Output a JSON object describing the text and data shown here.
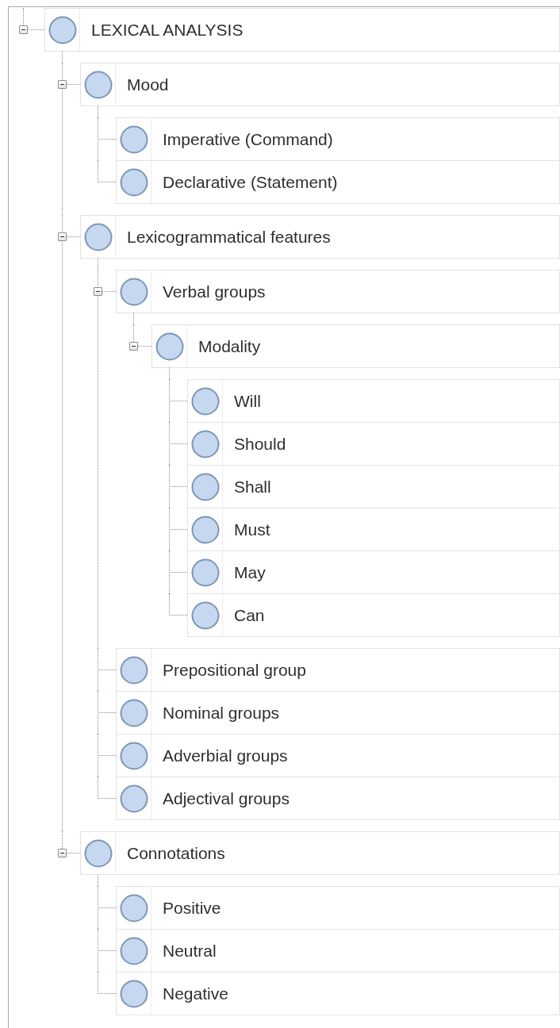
{
  "tree": [
    {
      "label": "LEXICAL ANALYSIS",
      "expanded": true,
      "children": [
        {
          "label": "Mood",
          "expanded": true,
          "children": [
            {
              "label": "Imperative (Command)"
            },
            {
              "label": "Declarative (Statement)"
            }
          ]
        },
        {
          "label": "Lexicogrammatical features",
          "expanded": true,
          "children": [
            {
              "label": "Verbal groups",
              "expanded": true,
              "children": [
                {
                  "label": "Modality",
                  "expanded": true,
                  "children": [
                    {
                      "label": "Will"
                    },
                    {
                      "label": "Should"
                    },
                    {
                      "label": "Shall"
                    },
                    {
                      "label": "Must"
                    },
                    {
                      "label": "May"
                    },
                    {
                      "label": "Can"
                    }
                  ]
                }
              ]
            },
            {
              "label": "Prepositional group"
            },
            {
              "label": "Nominal groups"
            },
            {
              "label": "Adverbial groups"
            },
            {
              "label": "Adjectival groups"
            }
          ]
        },
        {
          "label": "Connotations",
          "expanded": true,
          "children": [
            {
              "label": "Positive"
            },
            {
              "label": "Neutral"
            },
            {
              "label": "Negative"
            }
          ]
        }
      ]
    }
  ]
}
